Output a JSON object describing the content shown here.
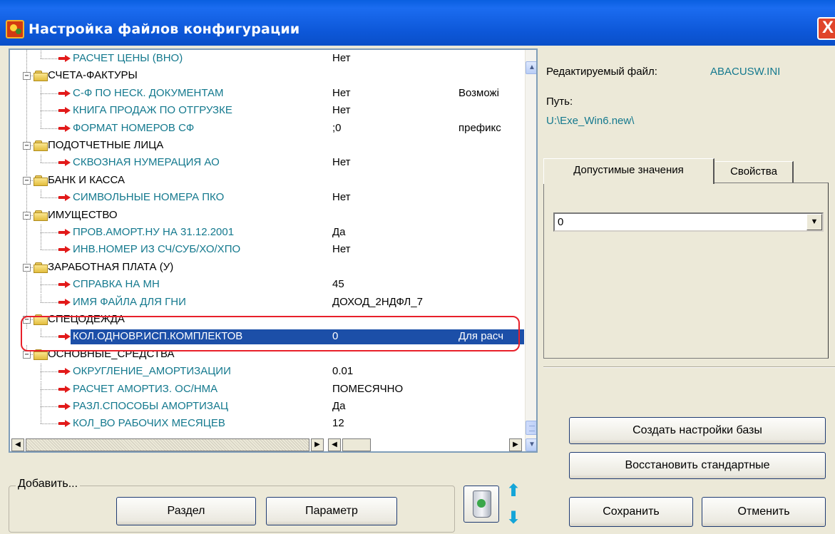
{
  "window": {
    "title": "Настройка файлов конфигурации",
    "close_label": "X"
  },
  "tree": {
    "rows": [
      {
        "kind": "param",
        "label": "РАСЧЕТ ЦЕНЫ (ВНО)",
        "value": "Нет",
        "desc": ""
      },
      {
        "kind": "section",
        "label": "СЧЕТА-ФАКТУРЫ",
        "value": "",
        "desc": ""
      },
      {
        "kind": "param",
        "label": "С-Ф ПО НЕСК. ДОКУМЕНТАМ",
        "value": "Нет",
        "desc": "Возможі"
      },
      {
        "kind": "param",
        "label": "КНИГА ПРОДАЖ ПО ОТГРУЗКЕ",
        "value": "Нет",
        "desc": ""
      },
      {
        "kind": "param",
        "label": "ФОРМАТ НОМЕРОВ СФ",
        "value": ";0",
        "desc": "префикс"
      },
      {
        "kind": "section",
        "label": "ПОДОТЧЕТНЫЕ ЛИЦА",
        "value": "",
        "desc": ""
      },
      {
        "kind": "param",
        "label": "СКВОЗНАЯ НУМЕРАЦИЯ АО",
        "value": "Нет",
        "desc": ""
      },
      {
        "kind": "section",
        "label": "БАНК И КАССА",
        "value": "",
        "desc": ""
      },
      {
        "kind": "param",
        "label": "СИМВОЛЬНЫЕ НОМЕРА ПКО",
        "value": "Нет",
        "desc": ""
      },
      {
        "kind": "section",
        "label": "ИМУЩЕСТВО",
        "value": "",
        "desc": ""
      },
      {
        "kind": "param",
        "label": "ПРОВ.АМОРТ.НУ НА 31.12.2001",
        "value": "Да",
        "desc": ""
      },
      {
        "kind": "param",
        "label": "ИНВ.НОМЕР ИЗ СЧ/СУБ/ХО/ХПО",
        "value": "Нет",
        "desc": ""
      },
      {
        "kind": "section",
        "label": "ЗАРАБОТНАЯ ПЛАТА (У)",
        "value": "",
        "desc": ""
      },
      {
        "kind": "param",
        "label": "СПРАВКА НА МН",
        "value": "45",
        "desc": ""
      },
      {
        "kind": "param",
        "label": "ИМЯ ФАЙЛА ДЛЯ ГНИ",
        "value": "ДОХОД_2НДФЛ_7",
        "desc": ""
      },
      {
        "kind": "section",
        "label": "СПЕЦОДЕЖДА",
        "value": "",
        "desc": ""
      },
      {
        "kind": "param",
        "label": "КОЛ.ОДНОВР.ИСП.КОМПЛЕКТОВ",
        "value": "0",
        "desc": "Для расч",
        "selected": true
      },
      {
        "kind": "section",
        "label": "ОСНОВНЫЕ_СРЕДСТВА",
        "value": "",
        "desc": ""
      },
      {
        "kind": "param",
        "label": "ОКРУГЛЕНИЕ_АМОРТИЗАЦИИ",
        "value": "0.01",
        "desc": ""
      },
      {
        "kind": "param",
        "label": "РАСЧЕТ АМОРТИЗ. ОС/НМА",
        "value": "ПОМЕСЯЧНО",
        "desc": ""
      },
      {
        "kind": "param",
        "label": "РАЗЛ.СПОСОБЫ АМОРТИЗАЦ",
        "value": "Да",
        "desc": ""
      },
      {
        "kind": "param",
        "label": "КОЛ_ВО РАБОЧИХ МЕСЯЦЕВ",
        "value": "12",
        "desc": ""
      }
    ]
  },
  "file_info": {
    "edited_label": "Редактируемый файл:",
    "edited_value": "ABACUSW.INI",
    "path_label": "Путь:",
    "path_value": "U:\\Exe_Win6.new\\"
  },
  "tabs": {
    "allowed": "Допустимые значения",
    "properties": "Свойства"
  },
  "combo": {
    "value": "0"
  },
  "add_group": {
    "legend": "Добавить...",
    "section_button": "Раздел",
    "param_button": "Параметр"
  },
  "buttons": {
    "create": "Создать настройки базы",
    "restore": "Восстановить стандартные",
    "save": "Сохранить",
    "cancel": "Отменить"
  },
  "glyphs": {
    "up": "▲",
    "down": "▼",
    "left": "◀",
    "right": "▶",
    "move_up": "⬆",
    "move_down": "⬇",
    "combo_down": "▼",
    "minus": "−"
  },
  "colors": {
    "title_bar": "#0d57d8",
    "param_text": "#14798e",
    "selection": "#1c4fa8",
    "highlight_outline": "#e8202a"
  }
}
